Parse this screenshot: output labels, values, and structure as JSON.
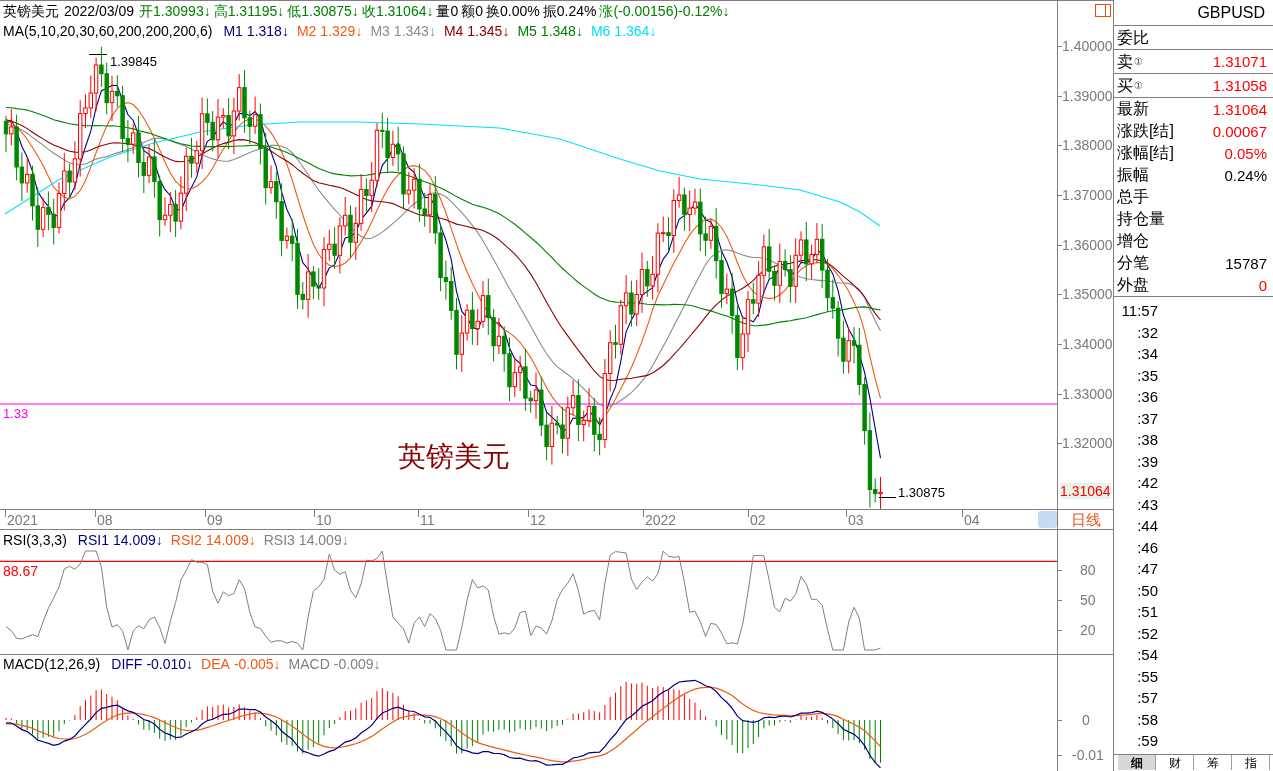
{
  "header": {
    "instrument": "英镑美元",
    "date": "2022/03/09",
    "quotes": [
      {
        "text": "开1.30993↓",
        "color": "#008000"
      },
      {
        "text": "高1.31195↓",
        "color": "#008000"
      },
      {
        "text": "低1.30875↓",
        "color": "#008000"
      },
      {
        "text": "收1.31064↓",
        "color": "#008000"
      },
      {
        "text": "量0",
        "color": "#000000"
      },
      {
        "text": "额0",
        "color": "#000000"
      },
      {
        "text": "换0.00%",
        "color": "#000000"
      },
      {
        "text": "振0.24%",
        "color": "#000000"
      },
      {
        "text": "涨(-0.00156)-0.12%↓",
        "color": "#008000"
      }
    ]
  },
  "ma_legend": {
    "title": "MA(5,10,20,30,60,200,200,200,6)",
    "items": [
      {
        "label": "M1",
        "value": "1.318↓",
        "color": "#000080"
      },
      {
        "label": "M2",
        "value": "1.329↓",
        "color": "#f05a14"
      },
      {
        "label": "M3",
        "value": "1.343↓",
        "color": "#8c8c8c"
      },
      {
        "label": "M4",
        "value": "1.345↓",
        "color": "#8b0000"
      },
      {
        "label": "M5",
        "value": "1.348↓",
        "color": "#008000"
      },
      {
        "label": "M6",
        "value": "1.364↓",
        "color": "#00e0ff"
      }
    ]
  },
  "price_chart": {
    "name_label": "英镑美元",
    "high_label": "1.39845",
    "low_label": "1.30875",
    "level_line_label": "1.33"
  },
  "price_axis": {
    "ticks": [
      "1.40000",
      "1.39000",
      "1.38000",
      "1.37000",
      "1.36000",
      "1.35000",
      "1.34000",
      "1.33000",
      "1.32000"
    ],
    "current": "1.31064"
  },
  "time_axis": {
    "labels": [
      "2021",
      "08",
      "09",
      "10",
      "11",
      "12",
      "2022",
      "02",
      "03",
      "04"
    ],
    "period": "日线"
  },
  "rsi": {
    "title": "RSI(3,3,3)",
    "items": [
      {
        "label": "RSI1",
        "value": "14.009↓",
        "color": "#000080"
      },
      {
        "label": "RSI2",
        "value": "14.009↓",
        "color": "#f05a14"
      },
      {
        "label": "RSI3",
        "value": "14.009↓",
        "color": "#808080"
      }
    ],
    "level_label": "88.67",
    "axis_ticks": [
      "80",
      "50",
      "20"
    ]
  },
  "macd": {
    "title": "MACD(12,26,9)",
    "items": [
      {
        "label": "DIFF",
        "value": "-0.010↓",
        "color": "#000080"
      },
      {
        "label": "DEA",
        "value": "-0.005↓",
        "color": "#f05a14"
      },
      {
        "label": "MACD",
        "value": "-0.009↓",
        "color": "#808080"
      }
    ],
    "axis_ticks": [
      "0",
      "-0.01"
    ]
  },
  "quote_panel": {
    "symbol": "GBPUSD",
    "sections": [
      [
        {
          "label": "委比"
        }
      ],
      [
        {
          "label": "卖",
          "badge": "①",
          "value": "1.31071",
          "color": "#ff0000"
        }
      ],
      [
        {
          "label": "买",
          "badge": "①",
          "value": "1.31058",
          "color": "#ff0000"
        }
      ],
      [
        {
          "label": "最新",
          "value": "1.31064",
          "color": "#ff0000"
        },
        {
          "label": "涨跌[结]",
          "value": "0.00067",
          "color": "#ff0000"
        },
        {
          "label": "涨幅[结]",
          "value": "0.05%",
          "color": "#ff0000"
        },
        {
          "label": "振幅",
          "value": "0.24%",
          "color": "#000000"
        },
        {
          "label": "总手"
        },
        {
          "label": "持仓量"
        },
        {
          "label": "增仓"
        },
        {
          "label": "分笔",
          "value": "15787",
          "color": "#000000"
        },
        {
          "label": "外盘",
          "value": "0",
          "color": "#ff0000"
        }
      ]
    ]
  },
  "ticks": [
    "11:57",
    ":32",
    ":34",
    ":35",
    ":36",
    ":37",
    ":38",
    ":39",
    ":42",
    ":43",
    ":44",
    ":46",
    ":47",
    ":50",
    ":51",
    ":52",
    ":54",
    ":55",
    ":57",
    ":58",
    ":59"
  ],
  "bottom_tabs": [
    {
      "label": "细",
      "selected": true
    },
    {
      "label": "财",
      "selected": false
    },
    {
      "label": "筹",
      "selected": false
    },
    {
      "label": "指",
      "selected": false
    }
  ]
}
